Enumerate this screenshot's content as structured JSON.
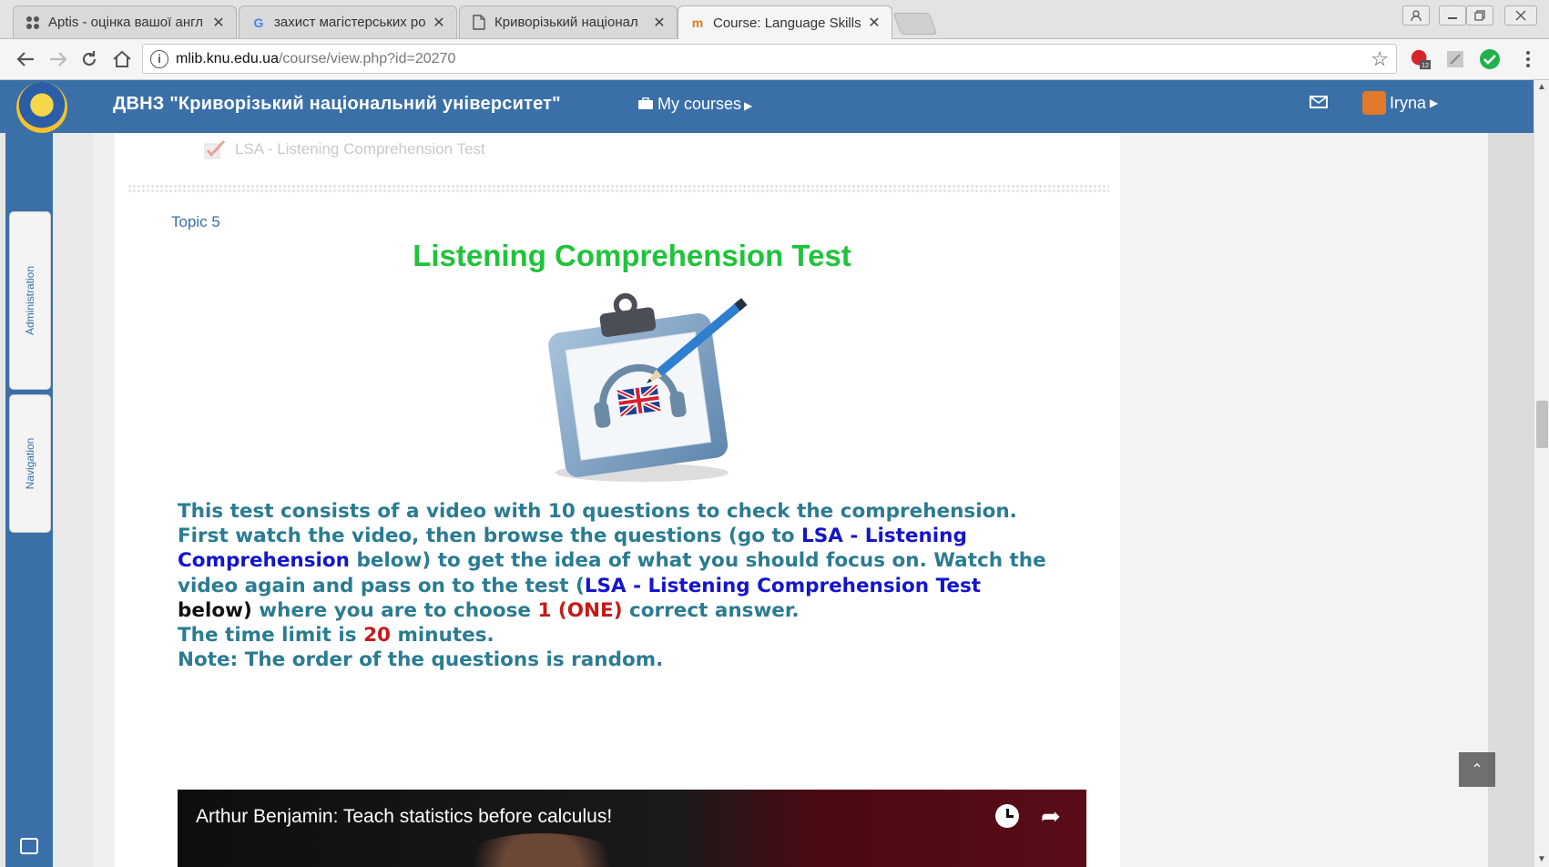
{
  "browser": {
    "tabs": [
      {
        "title": "Aptis - оцінка вашої англ",
        "close": "✕",
        "active": false
      },
      {
        "title": "захист магістерських ро",
        "close": "✕",
        "active": false
      },
      {
        "title": "Криворізький націонал",
        "close": "✕",
        "active": false
      },
      {
        "title": "Course: Language Skills A",
        "close": "✕",
        "active": true
      }
    ],
    "url_host": "mlib.knu.edu.ua",
    "url_path": "/course/view.php?id=20270",
    "extension_badge": "12"
  },
  "site": {
    "name": "ДВНЗ \"Криворізький національний університет\"",
    "my_courses": "My courses",
    "user_name": "Iryna"
  },
  "sidebar": {
    "administration": "Administration",
    "navigation": "Navigation"
  },
  "content": {
    "previous_activity": "LSA - Listening Comprehension Test",
    "topic": "Topic 5",
    "heading": "Listening Comprehension Test",
    "para": {
      "l1": "This test consists of a video with 10 questions to check the comprehension.",
      "l2a": "First watch the video, then browse the questions (go to ",
      "l2b": "LSA - Listening",
      "l3a": "Comprehension",
      "l3b": " below) to get the idea of what you should focus on. Watch the",
      "l4a": "video again and pass on to the test (",
      "l4b": "LSA - Listening Comprehension Test",
      "l5a": "below)",
      "l5b": " where you are to choose ",
      "l5c": "1 (ONE)",
      "l5d": " correct answer.",
      "l6a": "The time limit is ",
      "l6b": "20",
      "l6c": " minutes.",
      "l7": "Note: The order of the questions is random."
    },
    "video_title": "Arthur Benjamin: Teach statistics before calculus!"
  },
  "colors": {
    "site_bar": "#3a6fa8",
    "heading_green": "#20c33c",
    "text_teal": "#2a7c91",
    "link_blue": "#1414cf",
    "emphasis_red": "#c51a1a"
  }
}
